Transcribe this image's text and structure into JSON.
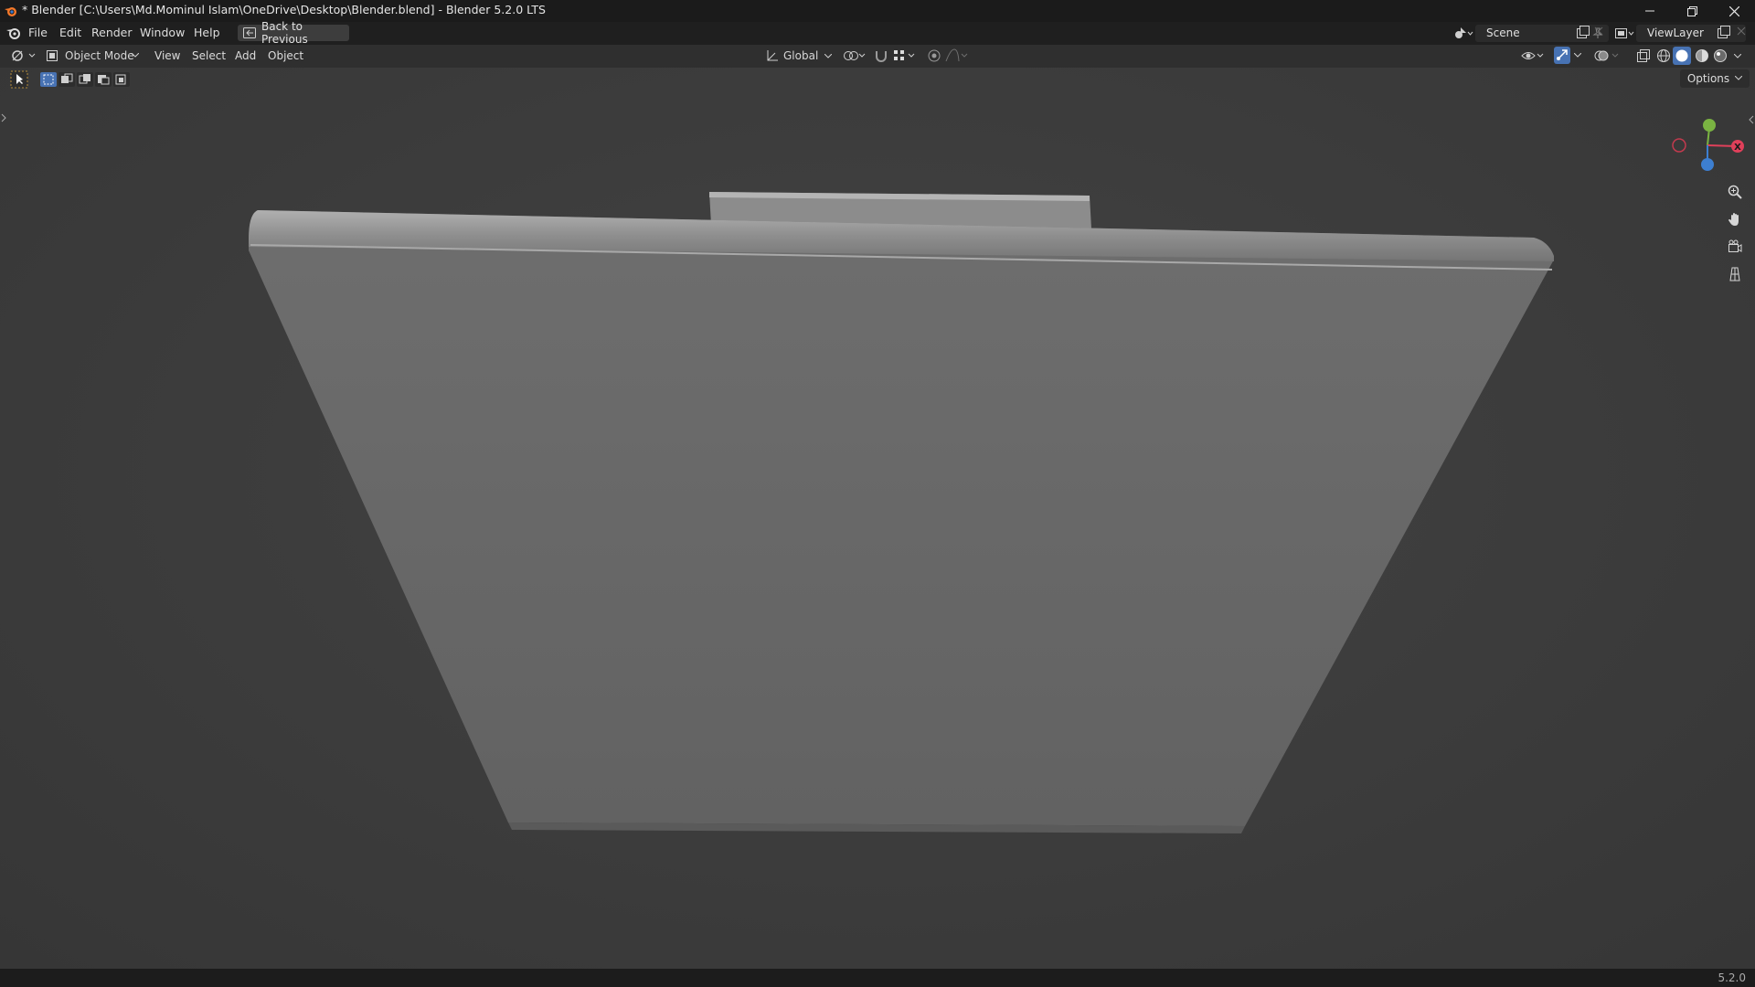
{
  "app": {
    "window_title": "* Blender [C:\\Users\\Md.Mominul Islam\\OneDrive\\Desktop\\Blender.blend] - Blender 5.2.0 LTS",
    "version": "5.2.0"
  },
  "menubar": {
    "items": [
      "File",
      "Edit",
      "Render",
      "Window",
      "Help"
    ],
    "back_label": "Back to Previous",
    "scene": "Scene",
    "view_layer": "ViewLayer"
  },
  "header": {
    "mode": "Object Mode",
    "menus": [
      "View",
      "Select",
      "Add",
      "Object"
    ],
    "transform_orientation": "Global"
  },
  "viewport": {
    "options_label": "Options",
    "gizmo_x_label": "X",
    "colors": {
      "x_axis": "#e0405a",
      "y_axis": "#7ab342",
      "z_axis": "#3d7fd1",
      "active": "#4772b3"
    }
  },
  "icons": [
    "blender-logo-icon",
    "minimize-icon",
    "maximize-icon",
    "close-icon",
    "back-icon",
    "cursor-select-icon",
    "zoom-icon",
    "pan-hand-icon",
    "camera-icon",
    "ortho-grid-icon"
  ]
}
